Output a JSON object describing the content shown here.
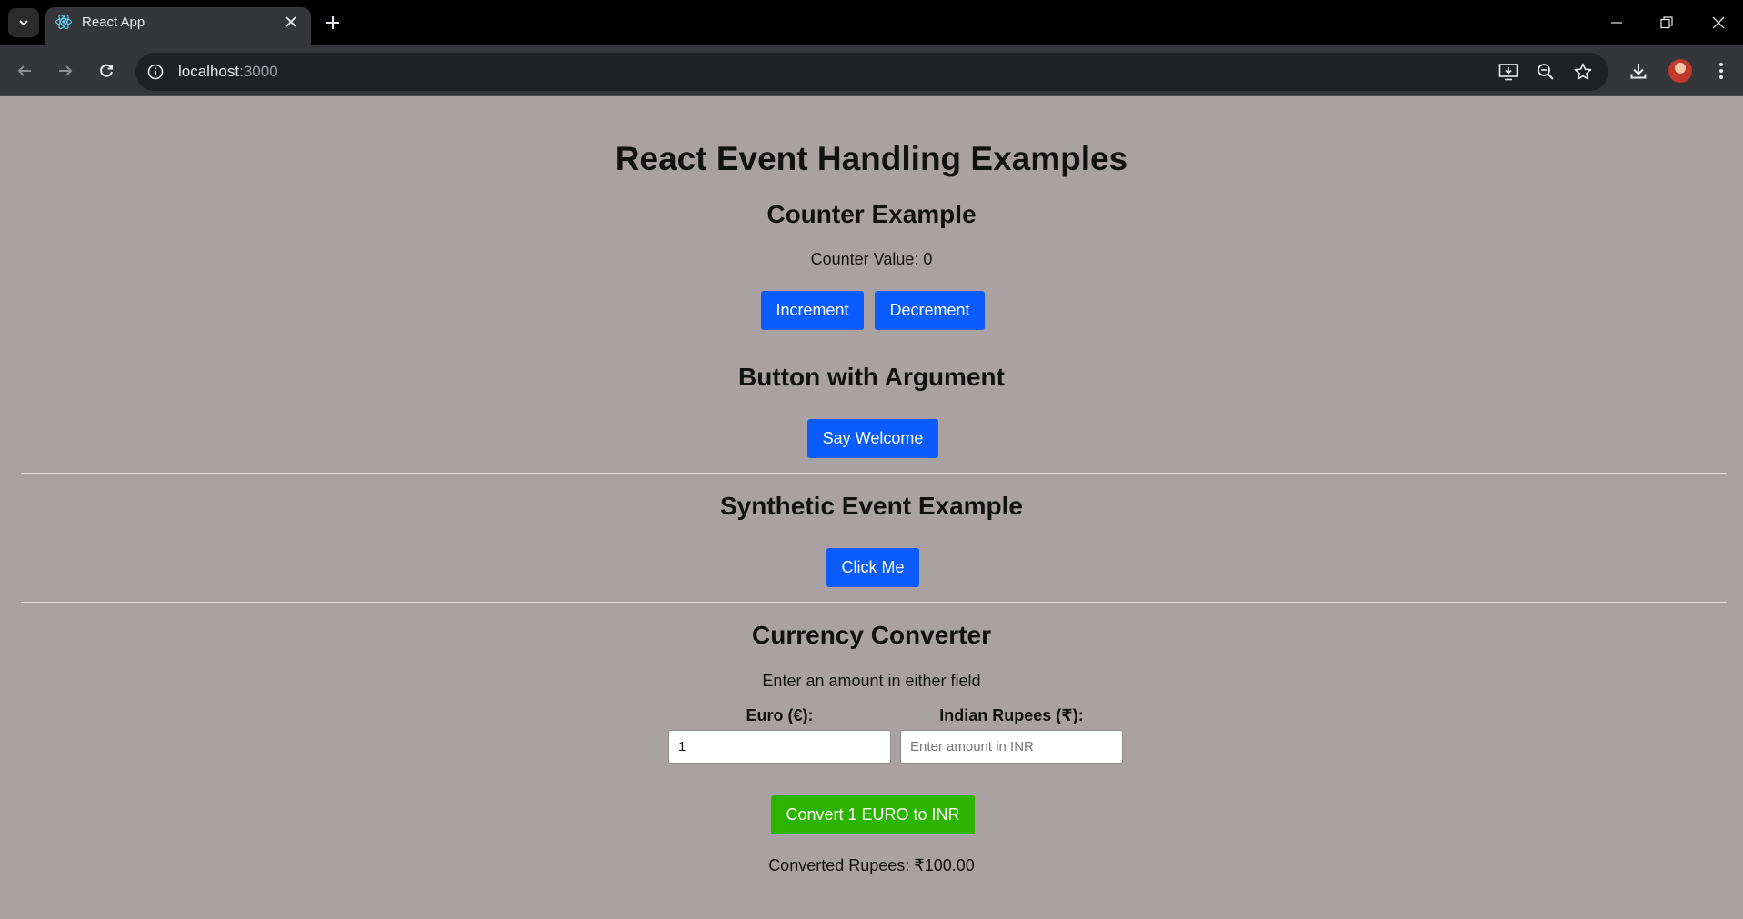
{
  "browser": {
    "tab_title": "React App",
    "url_host": "localhost",
    "url_port": ":3000"
  },
  "page": {
    "title": "React Event Handling Examples",
    "counter": {
      "heading": "Counter Example",
      "value_text": "Counter Value: 0",
      "increment_label": "Increment",
      "decrement_label": "Decrement"
    },
    "argument": {
      "heading": "Button with Argument",
      "button_label": "Say Welcome"
    },
    "synthetic": {
      "heading": "Synthetic Event Example",
      "button_label": "Click Me"
    },
    "converter": {
      "heading": "Currency Converter",
      "instruction": "Enter an amount in either field",
      "euro_label": "Euro (€):",
      "euro_value": "1",
      "inr_label": "Indian Rupees (₹):",
      "inr_placeholder": "Enter amount in INR",
      "convert_label": "Convert 1 EURO to INR",
      "result_text": "Converted Rupees: ₹100.00"
    }
  },
  "colors": {
    "page_bg": "#aaa2a2",
    "primary_button": "#0b5cff",
    "convert_button": "#2db400"
  }
}
